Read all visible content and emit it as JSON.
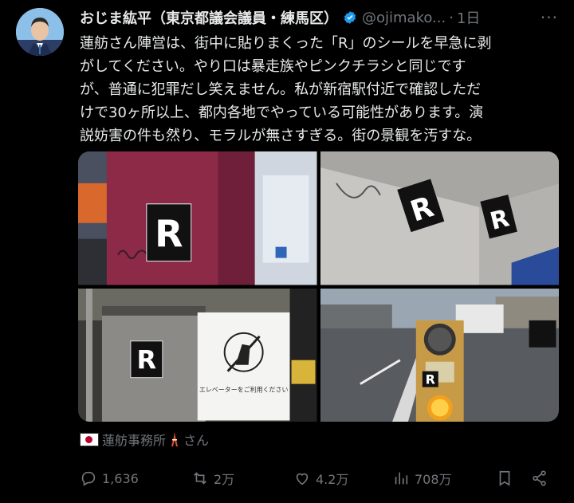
{
  "tweet": {
    "author_name": "おじま紘平（東京都議会議員・練馬区）",
    "handle": "@ojimako...",
    "separator": "·",
    "time": "1日",
    "more_label": "···",
    "lines": [
      "蓮舫さん陣営は、街中に貼りまくった「R」のシールを早急に剥",
      "がしてください。やり口は暴走族やピンクチラシと同じです",
      "が、普通に犯罪だし笑えません。私が新宿駅付近で確認しただ",
      "けで30ヶ所以上、都内各地でやっている可能性があります。演",
      "説妨害の件も然り、モラルが無さすぎる。街の景観を汚すな。"
    ]
  },
  "media": {
    "sticker_letter": "R",
    "elevator_sign_text": "エレベーターをご利用ください"
  },
  "credit": {
    "text": "蓮舫事務所",
    "suffix": "さん"
  },
  "actions": {
    "replies": "1,636",
    "reposts": "2万",
    "likes": "4.2万",
    "views": "708万"
  },
  "colors": {
    "background": "#000000",
    "text": "#e7e9ea",
    "muted": "#71767b",
    "verified": "#1d9bf0"
  }
}
